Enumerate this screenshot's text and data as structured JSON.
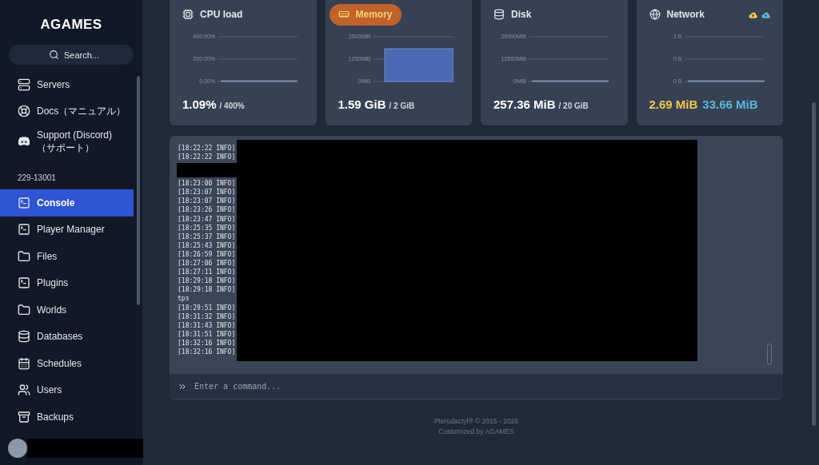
{
  "sidebar": {
    "logo": "AGAMES",
    "search": {
      "placeholder": "Search..."
    },
    "top_items": [
      {
        "label": "Servers",
        "selected": false
      },
      {
        "label": "Docs（マニュアル）",
        "selected": false
      },
      {
        "label": "Support (Discord)（サポート）",
        "selected": false
      }
    ],
    "section_label": "229-13001",
    "server_items": [
      {
        "label": "Console",
        "selected": true
      },
      {
        "label": "Player Manager",
        "selected": false
      },
      {
        "label": "Files",
        "selected": false
      },
      {
        "label": "Plugins",
        "selected": false
      },
      {
        "label": "Worlds",
        "selected": false
      },
      {
        "label": "Databases",
        "selected": false
      },
      {
        "label": "Schedules",
        "selected": false
      },
      {
        "label": "Users",
        "selected": false
      },
      {
        "label": "Backups",
        "selected": false
      }
    ],
    "user": {
      "redacted": true
    }
  },
  "stats": [
    {
      "title": "CPU load",
      "selected": false,
      "kind": "line",
      "axis_labels": [
        "400.00%",
        "200.00%",
        "0.00%"
      ],
      "values": [
        {
          "text": "1.09%",
          "color": "#ffffff"
        }
      ],
      "limit": "/ 400%"
    },
    {
      "title": "Memory",
      "selected": true,
      "kind": "area",
      "axis_labels": [
        "2500MiB",
        "1250MiB",
        "0MiB"
      ],
      "values": [
        {
          "text": "1.59 GiB",
          "color": "#ffffff"
        }
      ],
      "limit": "/ 2 GiB"
    },
    {
      "title": "Disk",
      "selected": false,
      "kind": "line",
      "axis_labels": [
        "25000MiB",
        "12500MiB",
        "0MiB"
      ],
      "values": [
        {
          "text": "257.36 MiB",
          "color": "#ffffff"
        }
      ],
      "limit": "/ 20 GiB"
    },
    {
      "title": "Network",
      "selected": false,
      "kind": "line",
      "axis_labels": [
        "1 B",
        "0 B",
        "0 B"
      ],
      "legend": [
        {
          "color": "#f1c94b"
        },
        {
          "color": "#5ab8dc"
        }
      ],
      "values": [
        {
          "text": "2.69 MiB",
          "color": "#f1c94b"
        },
        {
          "text": "33.66 MiB",
          "color": "#5ab8dc"
        }
      ]
    }
  ],
  "console": {
    "lines": [
      {
        "kind": "text",
        "text": "[18:22:22 INFO]"
      },
      {
        "kind": "text",
        "text": "[18:22:22 INFO]"
      },
      {
        "kind": "redacted"
      },
      {
        "kind": "text",
        "text": "[18:23:00 INFO]"
      },
      {
        "kind": "text",
        "text": "[18:23:07 INFO]"
      },
      {
        "kind": "text",
        "text": "[18:23:07 INFO]"
      },
      {
        "kind": "text",
        "text": "[18:23:26 INFO]"
      },
      {
        "kind": "text",
        "text": "[18:23:47 INFO]"
      },
      {
        "kind": "text",
        "text": "[18:25:35 INFO]"
      },
      {
        "kind": "text",
        "text": "[18:25:37 INFO]"
      },
      {
        "kind": "text",
        "text": "[18:25:43 INFO]"
      },
      {
        "kind": "text",
        "text": "[18:26:59 INFO]"
      },
      {
        "kind": "text",
        "text": "[18:27:06 INFO]"
      },
      {
        "kind": "text",
        "text": "[18:27:11 INFO]"
      },
      {
        "kind": "text",
        "text": "[18:29:18 INFO]"
      },
      {
        "kind": "text",
        "text": "[18:29:18 INFO]"
      },
      {
        "kind": "text",
        "text": "tps"
      },
      {
        "kind": "text",
        "text": "[18:29:51 INFO]"
      },
      {
        "kind": "text",
        "text": "[18:31:32 INFO]"
      },
      {
        "kind": "text",
        "text": "[18:31:43 INFO]"
      },
      {
        "kind": "text",
        "text": "[18:31:51 INFO]"
      },
      {
        "kind": "text",
        "text": "[18:32:16 INFO]"
      },
      {
        "kind": "text",
        "text": "[18:32:16 INFO]"
      }
    ],
    "redacted": true,
    "command": {
      "placeholder": "Enter a command..."
    }
  },
  "footer": [
    "Pterodactyl® © 2015 - 2026",
    "Customized by AGAMES"
  ]
}
